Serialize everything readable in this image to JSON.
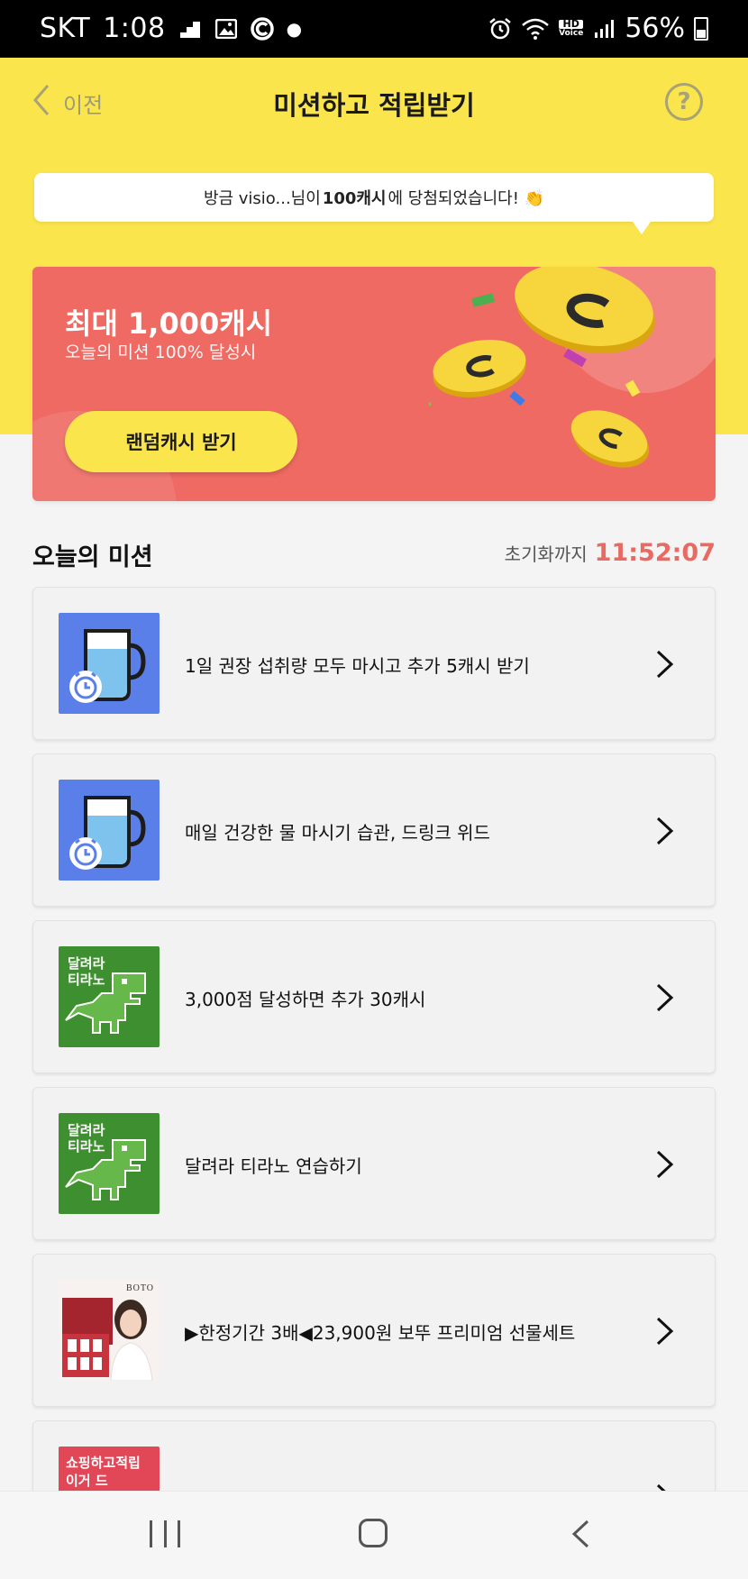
{
  "status_bar": {
    "carrier": "SKT",
    "time": "1:08",
    "hd_voice_top": "HD",
    "hd_voice_bottom": "Voice",
    "battery": "56%"
  },
  "header": {
    "back_label": "이전",
    "title": "미션하고 적립받기",
    "help_label": "?"
  },
  "notice": {
    "prefix": "방금 visio...님이 ",
    "highlight": "100캐시",
    "suffix": "에 당첨되었습니다! 👏"
  },
  "banner": {
    "title": "최대 1,000캐시",
    "subtitle": "오늘의 미션 100% 달성시",
    "button_label": "랜덤캐시 받기"
  },
  "missions_section": {
    "title": "오늘의 미션",
    "reset_label": "초기화까지",
    "reset_time": "11:52:07"
  },
  "missions": [
    {
      "label": "1일 권장 섭취량 모두 마시고 추가 5캐시 받기",
      "thumb": "water-cup-alarm-icon"
    },
    {
      "label": "매일 건강한 물 마시기 습관, 드링크 위드",
      "thumb": "water-cup-alarm-icon"
    },
    {
      "label": "3,000점 달성하면 추가 30캐시",
      "thumb": "dinosaur-game-icon",
      "thumb_text_1": "달려라",
      "thumb_text_2": "티라노"
    },
    {
      "label": "달려라 티라노 연습하기",
      "thumb": "dinosaur-game-icon",
      "thumb_text_1": "달려라",
      "thumb_text_2": "티라노"
    },
    {
      "label": "▶한정기간 3배◀23,900원 보뚜 프리미엄 선물세트",
      "thumb": "gift-set-product-image",
      "thumb_brand": "BOTO"
    },
    {
      "label": "",
      "thumb": "shopping-reward-icon",
      "thumb_text_1": "쇼핑하고적립",
      "thumb_text_2": "이거 드"
    }
  ],
  "colors": {
    "header_yellow": "#fbe54d",
    "banner_red": "#ee6a62",
    "timer_red": "#e96a62",
    "water_blue": "#5b7fe8",
    "tirano_green": "#3e8f2f"
  }
}
